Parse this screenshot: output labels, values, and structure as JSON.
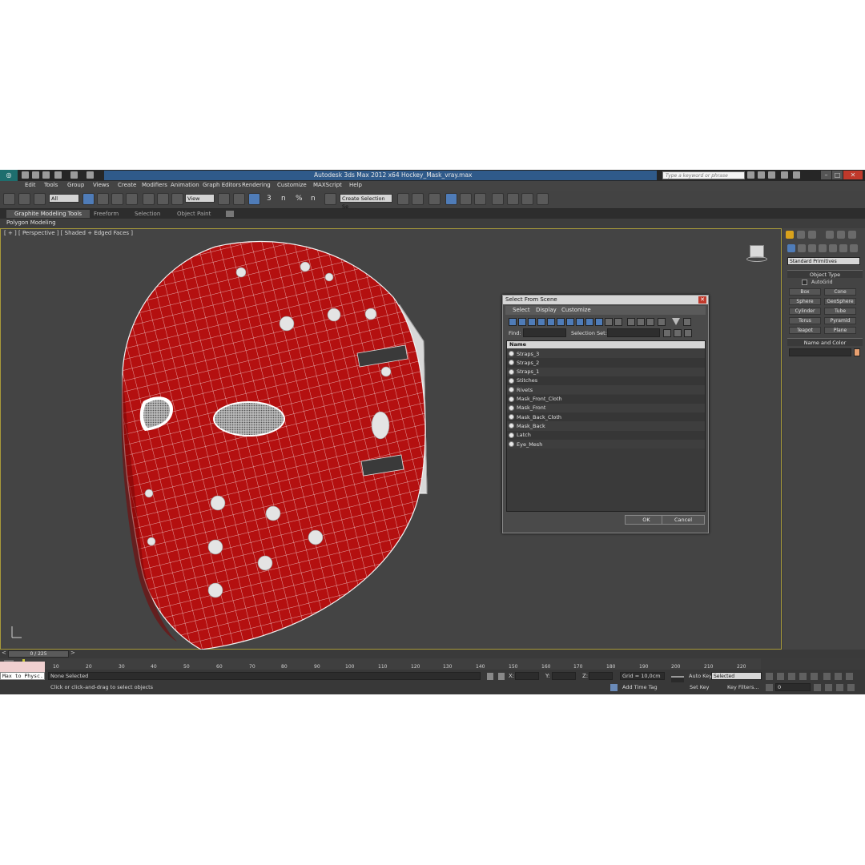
{
  "app": {
    "title": "Autodesk 3ds Max  2012 x64      Hockey_Mask_vray.max",
    "search_placeholder": "Type a keyword or phrase"
  },
  "menu": [
    "Edit",
    "Tools",
    "Group",
    "Views",
    "Create",
    "Modifiers",
    "Animation",
    "Graph Editors",
    "Rendering",
    "Customize",
    "MAXScript",
    "Help"
  ],
  "toolbar": {
    "selection_filter": "All",
    "ref_coord": "View",
    "named_selection": "Create Selection Se",
    "snap_labels": [
      "3",
      "n",
      "%",
      "n"
    ]
  },
  "ribbon": {
    "tabs": [
      "Graphite Modeling Tools",
      "Freeform",
      "Selection",
      "Object Paint"
    ],
    "panel_label": "Polygon Modeling"
  },
  "viewport": {
    "label": "[ + ] [ Perspective ] [ Shaded + Edged Faces ]",
    "mesh_color": "#b41010",
    "wire_color": "#f0f0f0"
  },
  "dialog": {
    "title": "Select From Scene",
    "menu": [
      "Select",
      "Display",
      "Customize"
    ],
    "find_label": "Find:",
    "selection_set_label": "Selection Set:",
    "list_header": "Name",
    "items": [
      "Straps_3",
      "Straps_2",
      "Straps_1",
      "Stitches",
      "Rivets",
      "Mask_Front_Cloth",
      "Mask_Front",
      "Mask_Back_Cloth",
      "Mask_Back",
      "Latch",
      "Eye_Mesh"
    ],
    "ok_label": "OK",
    "cancel_label": "Cancel"
  },
  "command_panel": {
    "dropdown": "Standard Primitives",
    "object_type_title": "Object Type",
    "autogrid_label": "AutoGrid",
    "buttons": [
      "Box",
      "Cone",
      "Sphere",
      "GeoSphere",
      "Cylinder",
      "Tube",
      "Torus",
      "Pyramid",
      "Teapot",
      "Plane"
    ],
    "name_color_title": "Name and Color",
    "color_swatch": "#e8a070"
  },
  "timeline": {
    "frame_display": "0 / 225",
    "ticks": [
      "10",
      "20",
      "30",
      "40",
      "50",
      "60",
      "70",
      "80",
      "90",
      "100",
      "110",
      "120",
      "130",
      "140",
      "150",
      "160",
      "170",
      "180",
      "190",
      "200",
      "210",
      "220"
    ]
  },
  "status": {
    "script_listener": "Max to Physc.",
    "selection": "None Selected",
    "prompt": "Click or click-and-drag to select objects",
    "x_label": "X:",
    "y_label": "Y:",
    "z_label": "Z:",
    "grid": "Grid = 10,0cm",
    "add_time_tag": "Add Time Tag",
    "auto_key": "Auto Key",
    "selected": "Selected",
    "set_key": "Set Key",
    "key_filters": "Key Filters...",
    "frame": "0"
  }
}
